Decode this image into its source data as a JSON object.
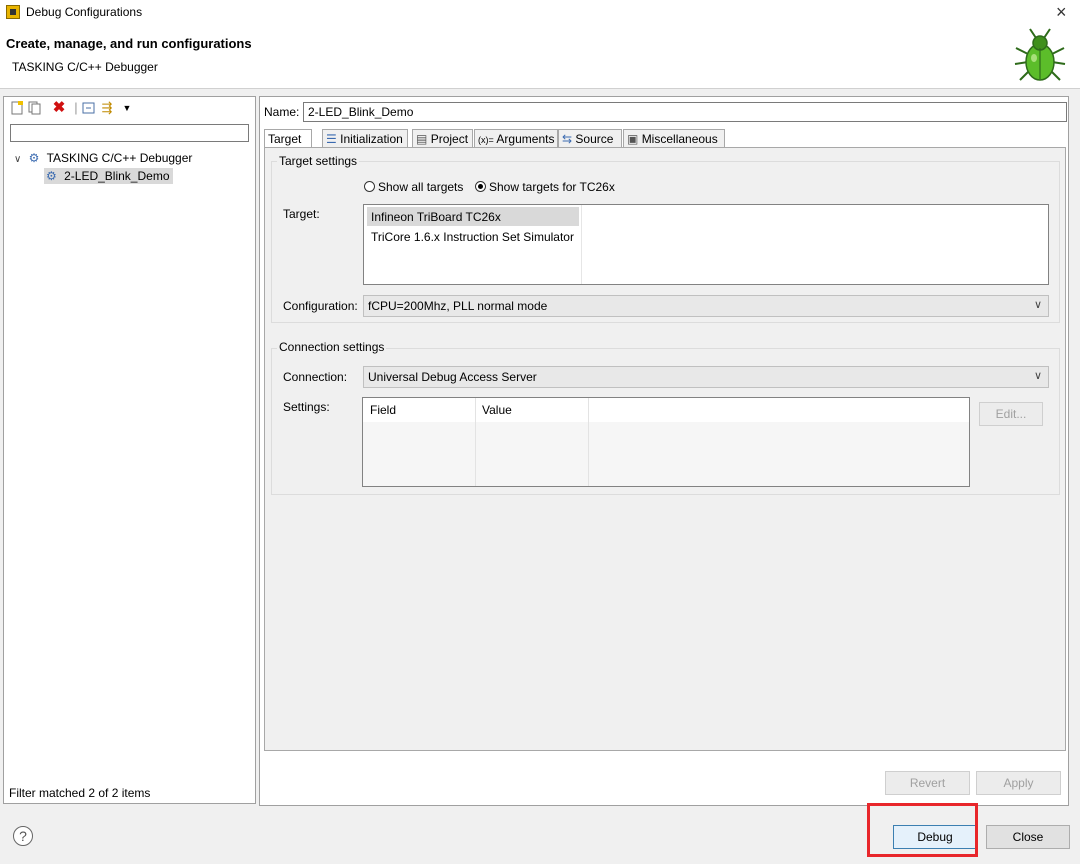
{
  "window": {
    "title": "Debug Configurations",
    "close_glyph": "×"
  },
  "header": {
    "title": "Create, manage, and run configurations",
    "subtitle": "TASKING C/C++ Debugger",
    "logo_icon": "bug-icon"
  },
  "left_panel": {
    "toolbar_icons": [
      "new-config-icon",
      "duplicate-icon",
      "delete-icon",
      "collapse-all-icon",
      "filter-icon",
      "dropdown-icon"
    ],
    "filter_value": "",
    "tree": [
      {
        "label": "TASKING C/C++ Debugger",
        "expanded": true,
        "icon": "debugger-type-icon"
      },
      {
        "label": "2-LED_Blink_Demo",
        "selected": true,
        "icon": "debug-config-icon"
      }
    ],
    "filter_status": "Filter matched 2 of 2 items"
  },
  "config": {
    "name_label": "Name:",
    "name_value": "2-LED_Blink_Demo",
    "tabs": [
      {
        "label": "Target",
        "icon": ""
      },
      {
        "label": "Initialization",
        "icon": "list-icon"
      },
      {
        "label": "Project",
        "icon": "document-icon"
      },
      {
        "label": "Arguments",
        "icon": "arguments-icon"
      },
      {
        "label": "Source",
        "icon": "source-icon"
      },
      {
        "label": "Miscellaneous",
        "icon": "window-icon"
      }
    ],
    "active_tab": "Target"
  },
  "target_settings": {
    "group_title": "Target settings",
    "radio_all": "Show all targets",
    "radio_filtered": "Show targets for TC26x",
    "selected_radio": "filtered",
    "target_label": "Target:",
    "targets": [
      "Infineon TriBoard TC26x",
      "TriCore 1.6.x Instruction Set Simulator"
    ],
    "selected_target": "Infineon TriBoard TC26x",
    "configuration_label": "Configuration:",
    "configuration_value": "fCPU=200Mhz, PLL normal mode"
  },
  "connection_settings": {
    "group_title": "Connection settings",
    "connection_label": "Connection:",
    "connection_value": "Universal Debug Access Server",
    "settings_label": "Settings:",
    "columns": [
      "Field",
      "Value"
    ],
    "rows": [],
    "edit_button": "Edit..."
  },
  "buttons": {
    "revert": "Revert",
    "apply": "Apply",
    "debug": "Debug",
    "close": "Close",
    "help": "?"
  },
  "colors": {
    "highlight": "#e8262b",
    "selection": "#d9d9d9"
  }
}
